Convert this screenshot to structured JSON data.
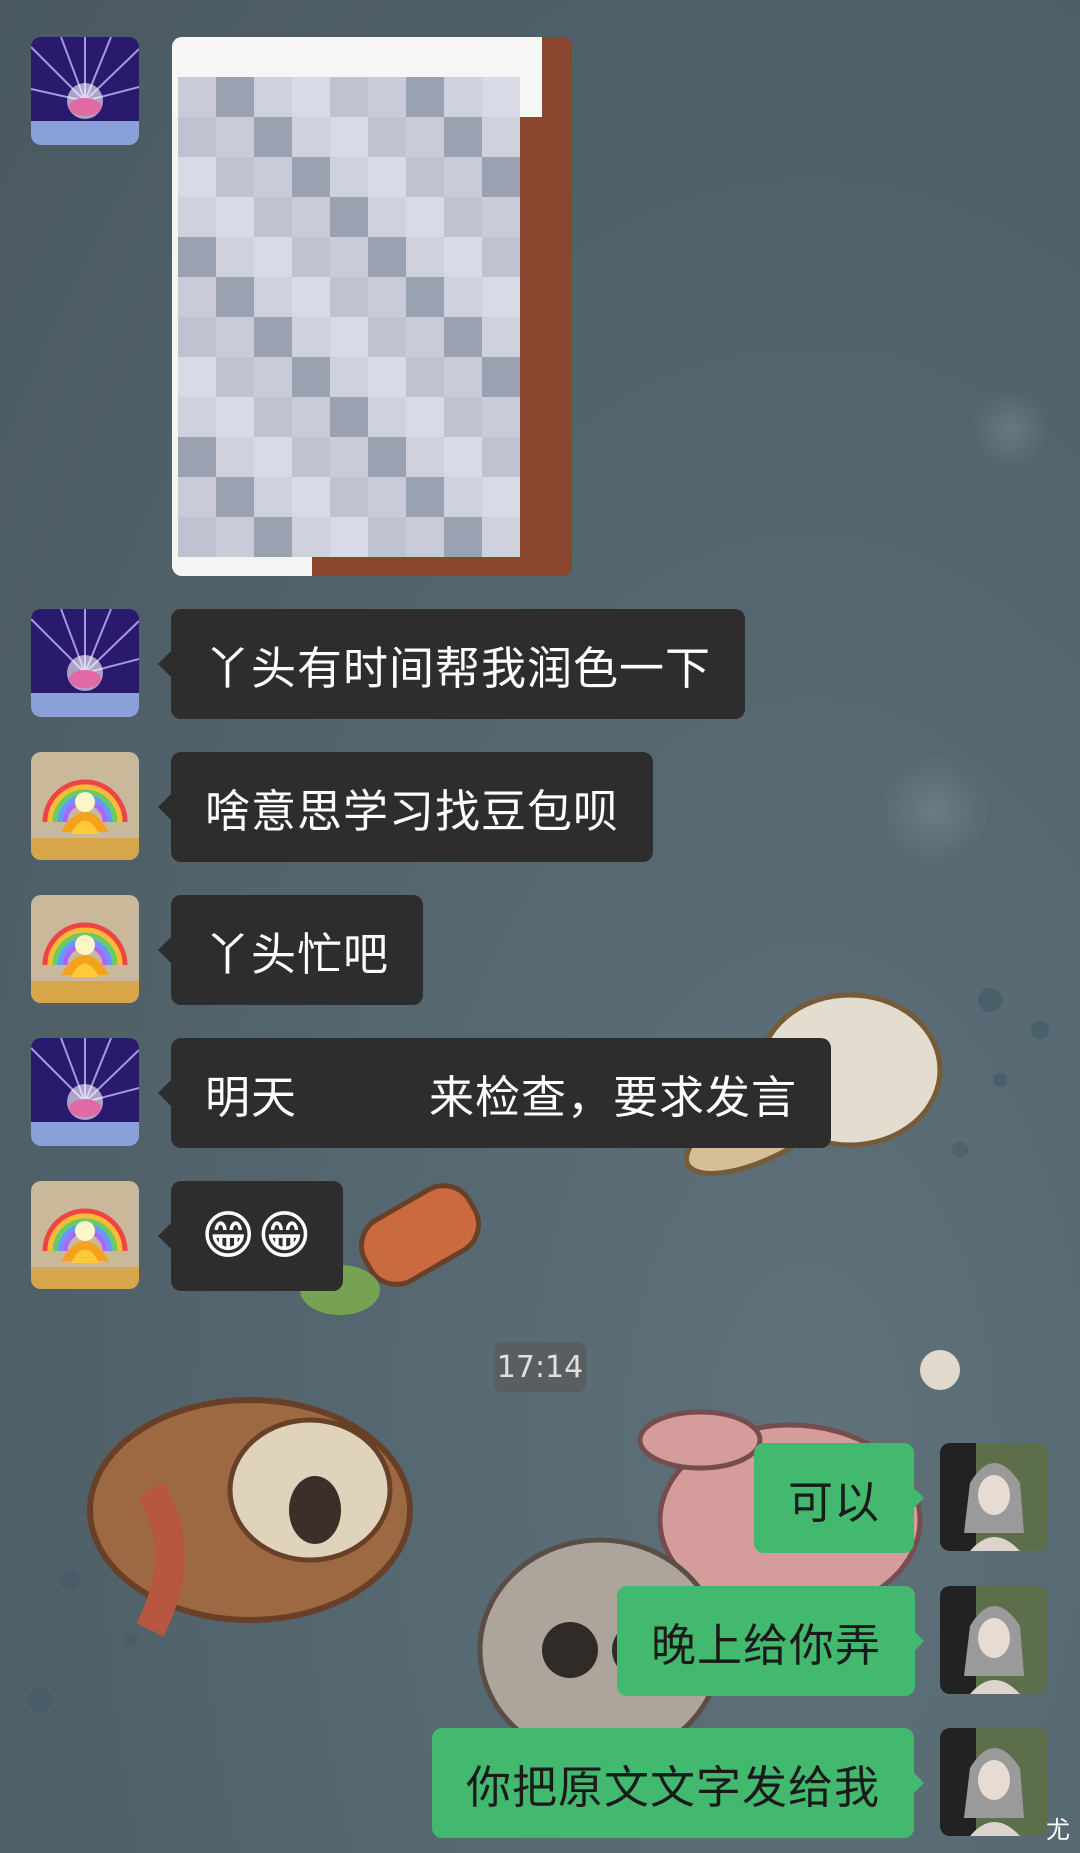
{
  "chat": {
    "messages": [
      {
        "id": "m1",
        "direction": "in",
        "type": "image",
        "sender": "lotus-purple"
      },
      {
        "id": "m2",
        "direction": "in",
        "type": "text",
        "sender": "lotus-purple",
        "text": "丫头有时间帮我润色一下"
      },
      {
        "id": "m3",
        "direction": "in",
        "type": "text",
        "sender": "lotus-rainbow",
        "text": "啥意思学习找豆包呗"
      },
      {
        "id": "m4",
        "direction": "in",
        "type": "text",
        "sender": "lotus-rainbow",
        "text": "丫头忙吧"
      },
      {
        "id": "m5",
        "direction": "in",
        "type": "text",
        "sender": "lotus-purple",
        "text_before": "明天",
        "text_after": "来检查，要求发言"
      },
      {
        "id": "m6",
        "direction": "in",
        "type": "emoji",
        "sender": "lotus-rainbow",
        "text": "😁😁"
      },
      {
        "id": "m7",
        "direction": "out",
        "type": "text",
        "text": "可以"
      },
      {
        "id": "m8",
        "direction": "out",
        "type": "text",
        "text": "晚上给你弄"
      },
      {
        "id": "m9",
        "direction": "out",
        "type": "text",
        "text": "你把原文文字发给我"
      }
    ],
    "timestamp": "17:14"
  },
  "corner_mark": "尤",
  "colors": {
    "incoming_bubble": "#2d2d2d",
    "outgoing_bubble": "#43b96f",
    "background": "#536570"
  },
  "icons": [
    "avatar-lotus-purple-icon",
    "avatar-lotus-rainbow-icon",
    "avatar-user-portrait-icon",
    "grin-emoji-icon"
  ]
}
